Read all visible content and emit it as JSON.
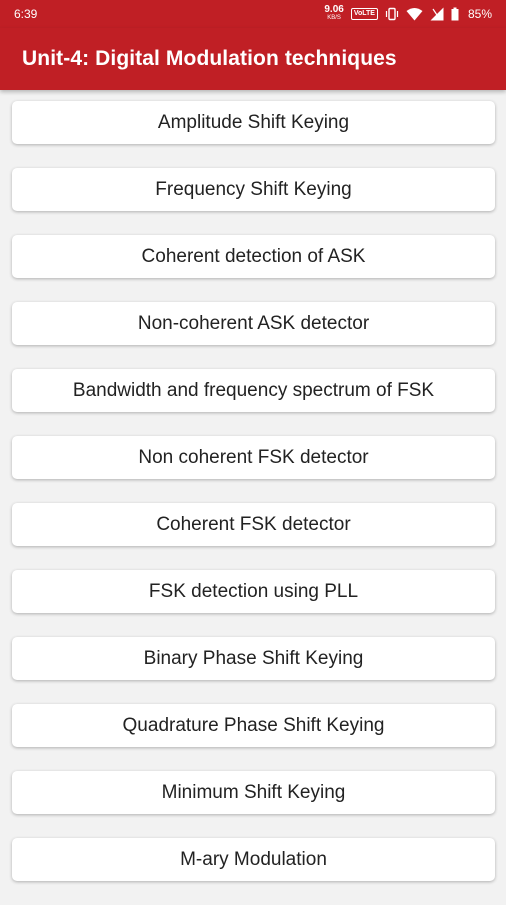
{
  "status_bar": {
    "time": "6:39",
    "net_speed_value": "9.06",
    "net_speed_unit": "KB/S",
    "volte": "VoLTE",
    "battery": "85%"
  },
  "app_bar": {
    "title": "Unit-4: Digital Modulation techniques",
    "background_color": "#c01f25"
  },
  "topics": [
    {
      "label": "Amplitude Shift Keying"
    },
    {
      "label": "Frequency Shift Keying"
    },
    {
      "label": "Coherent detection of ASK"
    },
    {
      "label": "Non-coherent ASK detector"
    },
    {
      "label": "Bandwidth and frequency spectrum of FSK"
    },
    {
      "label": "Non coherent FSK detector"
    },
    {
      "label": "Coherent FSK detector"
    },
    {
      "label": "FSK detection using PLL"
    },
    {
      "label": "Binary Phase Shift Keying"
    },
    {
      "label": "Quadrature Phase Shift Keying"
    },
    {
      "label": "Minimum Shift Keying"
    },
    {
      "label": "M-ary Modulation"
    }
  ]
}
